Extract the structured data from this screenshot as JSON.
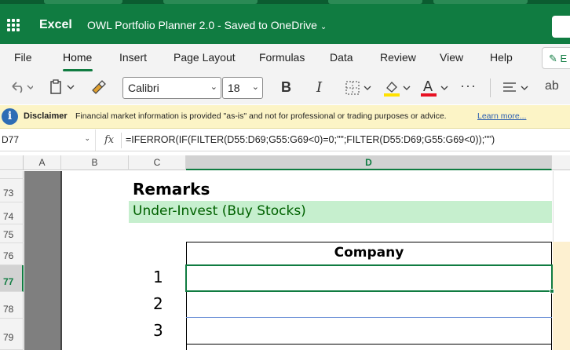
{
  "titlebar": {
    "app_name": "Excel",
    "document_title": "OWL Portfolio Planner 2.0",
    "save_status": "Saved to OneDrive"
  },
  "ribbon": {
    "tabs": [
      "File",
      "Home",
      "Insert",
      "Page Layout",
      "Formulas",
      "Data",
      "Review",
      "View",
      "Help"
    ],
    "active_tab": "Home",
    "editing_label": "E",
    "accent_color": "#107c41"
  },
  "toolbar": {
    "font_name": "Calibri",
    "font_size": "18",
    "bold_label": "B",
    "italic_label": "I",
    "font_color_label": "A",
    "more_label": "···",
    "wrap_label": "ab"
  },
  "disclaimer": {
    "label": "Disclaimer",
    "text": "Financial market information is provided \"as-is\" and not for professional or trading purposes or advice.",
    "link": "Learn more..."
  },
  "formula_bar": {
    "name_box": "D77",
    "fx_label": "fx",
    "formula": "=IFERROR(IF(FILTER(D55:D69;G55:G69<0)=0;\"\";FILTER(D55:D69;G55:G69<0));\"\")"
  },
  "grid": {
    "columns": [
      "A",
      "B",
      "C",
      "D"
    ],
    "selected_column": "D",
    "rows": [
      "73",
      "74",
      "75",
      "76",
      "77",
      "78",
      "79"
    ],
    "selected_row": "77"
  },
  "cells": {
    "remarks": "Remarks",
    "under_invest": "Under-Invest (Buy Stocks)",
    "company_header": "Company",
    "row_numbers": [
      "1",
      "2",
      "3"
    ]
  }
}
